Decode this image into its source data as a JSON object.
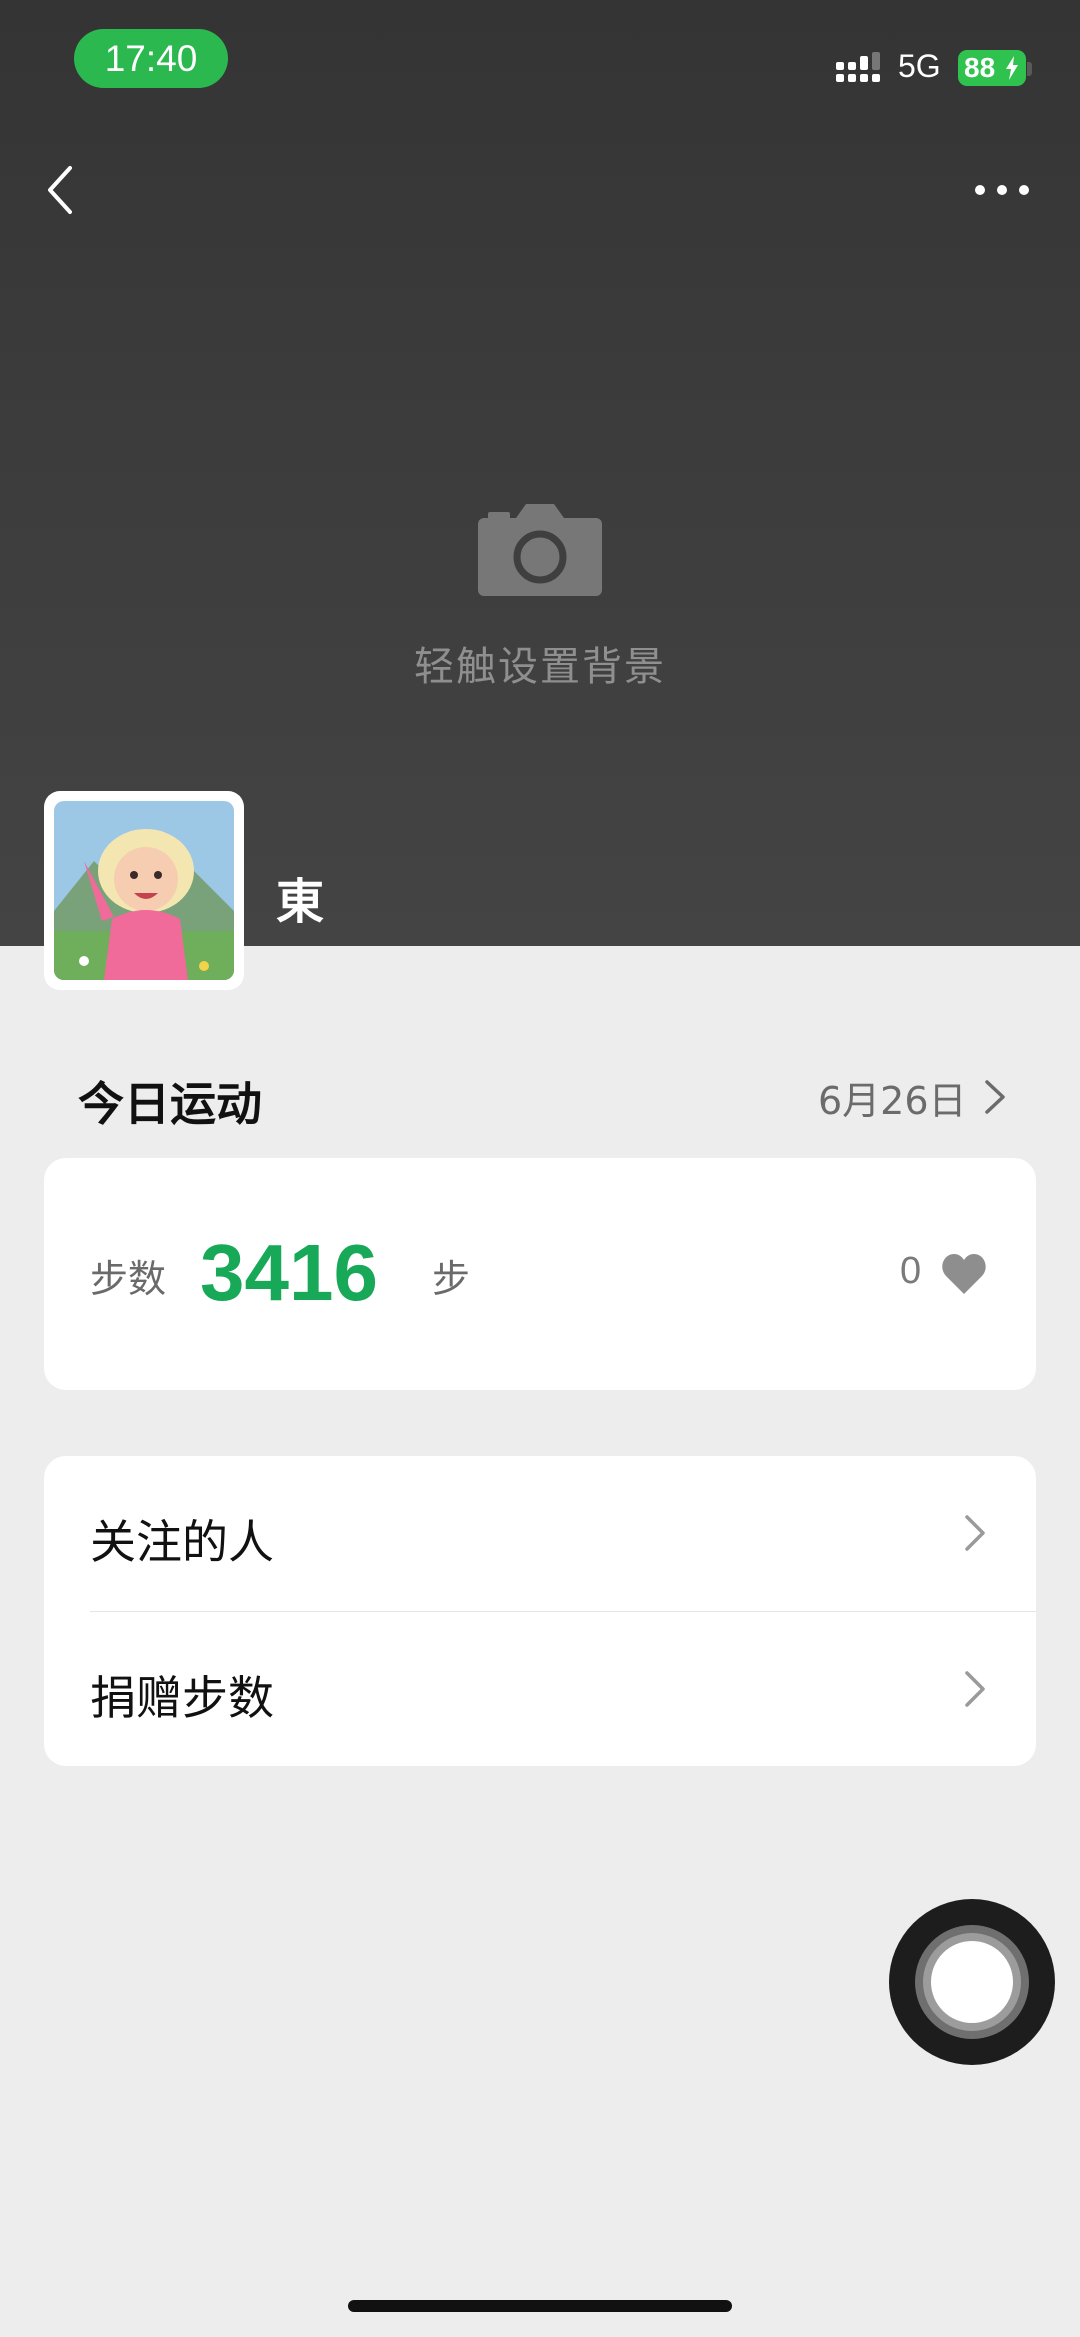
{
  "status_bar": {
    "time": "17:40",
    "network": "5G",
    "battery": "88"
  },
  "header": {
    "back_icon": "chevron-left-icon",
    "more_icon": "more-horizontal-icon"
  },
  "cover": {
    "camera_icon": "camera-icon",
    "hint": "轻触设置背景"
  },
  "profile": {
    "name": "東"
  },
  "today": {
    "title": "今日运动",
    "date": "6月26日"
  },
  "steps": {
    "label": "步数",
    "value": "3416",
    "unit": "步",
    "likes": "0",
    "like_icon": "heart-icon",
    "value_color": "#17a957"
  },
  "menu": [
    {
      "label": "关注的人"
    },
    {
      "label": "捐赠步数"
    }
  ],
  "colors": {
    "accent": "#17a957",
    "time_pill": "#2bb84e",
    "battery": "#30c24f"
  }
}
